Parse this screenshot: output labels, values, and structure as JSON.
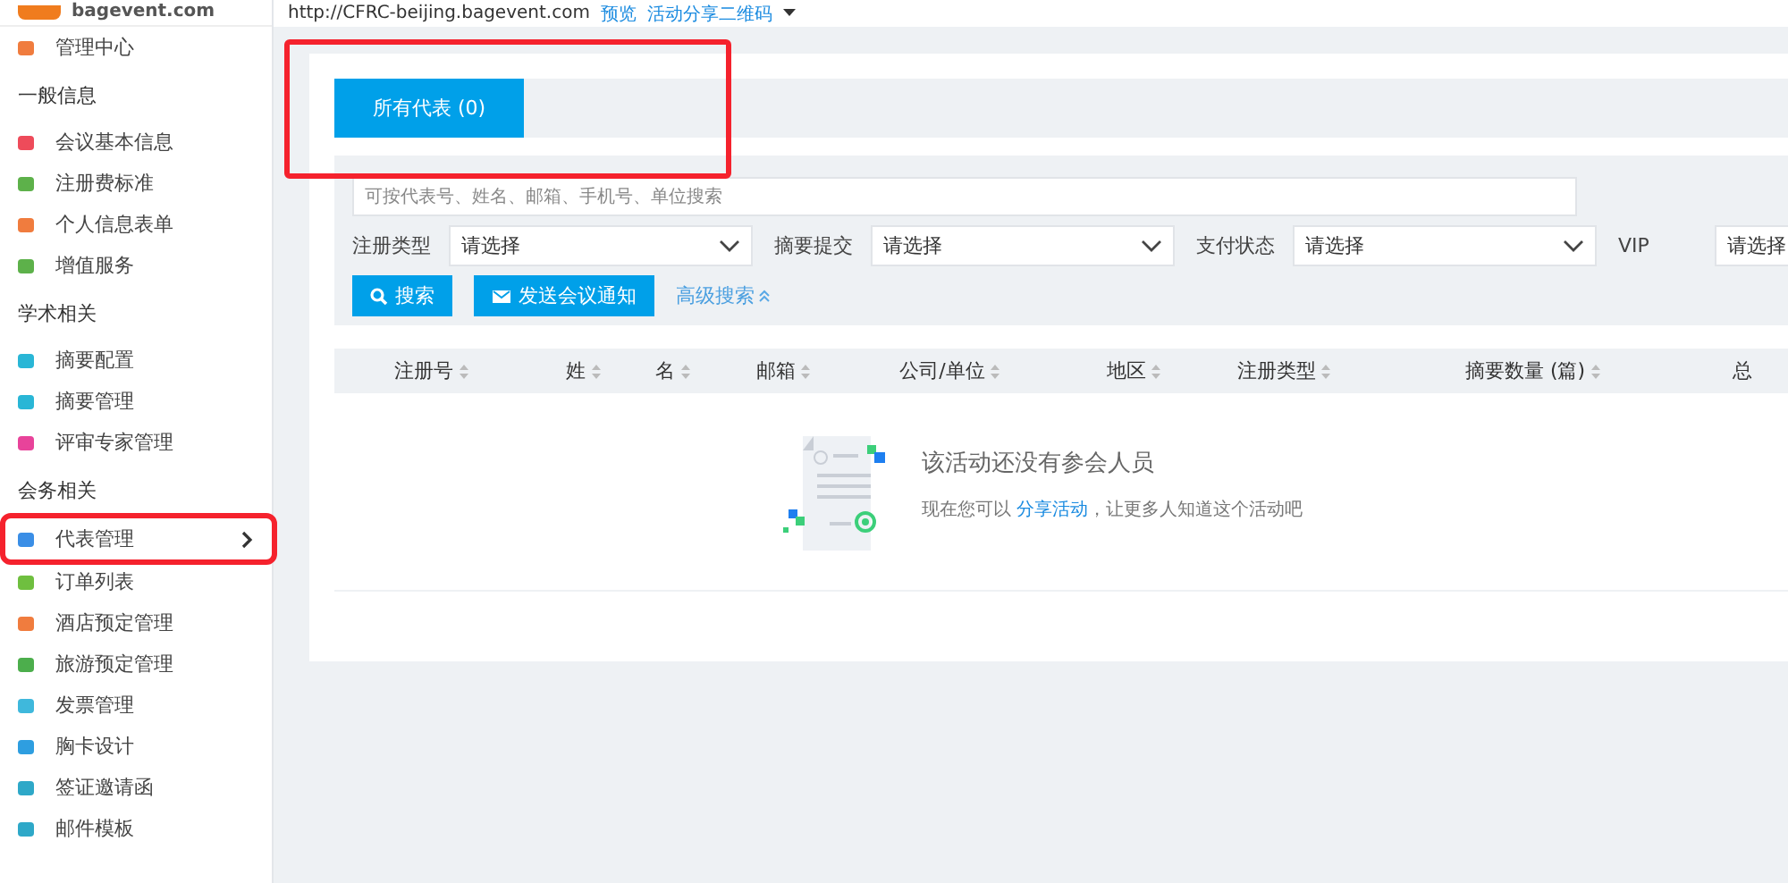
{
  "logo": {
    "text": "bagevent.com"
  },
  "topbar": {
    "url": "http://CFRC-beijing.bagevent.com",
    "links": [
      "预览",
      "活动分享二维码"
    ]
  },
  "sidebar": {
    "items": [
      {
        "kind": "link",
        "label": "管理中心",
        "color": "#f07c3e",
        "selected": false,
        "highlighted": false
      },
      {
        "kind": "heading",
        "label": "一般信息"
      },
      {
        "kind": "link",
        "label": "会议基本信息",
        "color": "#ee4b5a",
        "selected": false,
        "highlighted": false
      },
      {
        "kind": "link",
        "label": "注册费标准",
        "color": "#5db14a",
        "selected": false,
        "highlighted": false
      },
      {
        "kind": "link",
        "label": "个人信息表单",
        "color": "#f07c3e",
        "selected": false,
        "highlighted": false
      },
      {
        "kind": "link",
        "label": "增值服务",
        "color": "#5db14a",
        "selected": false,
        "highlighted": false
      },
      {
        "kind": "heading",
        "label": "学术相关"
      },
      {
        "kind": "link",
        "label": "摘要配置",
        "color": "#29b6d6",
        "selected": false,
        "highlighted": false
      },
      {
        "kind": "link",
        "label": "摘要管理",
        "color": "#29b6d6",
        "selected": false,
        "highlighted": false
      },
      {
        "kind": "link",
        "label": "评审专家管理",
        "color": "#e8439a",
        "selected": false,
        "highlighted": false
      },
      {
        "kind": "heading",
        "label": "会务相关"
      },
      {
        "kind": "link",
        "label": "代表管理",
        "color": "#3a8ee6",
        "selected": true,
        "highlighted": true
      },
      {
        "kind": "link",
        "label": "订单列表",
        "color": "#6fbf3f",
        "selected": false,
        "highlighted": false
      },
      {
        "kind": "link",
        "label": "酒店预定管理",
        "color": "#f07c3e",
        "selected": false,
        "highlighted": false
      },
      {
        "kind": "link",
        "label": "旅游预定管理",
        "color": "#4cae4c",
        "selected": false,
        "highlighted": false
      },
      {
        "kind": "link",
        "label": "发票管理",
        "color": "#3fb8dc",
        "selected": false,
        "highlighted": false
      },
      {
        "kind": "link",
        "label": "胸卡设计",
        "color": "#2e9ee0",
        "selected": false,
        "highlighted": false
      },
      {
        "kind": "link",
        "label": "签证邀请函",
        "color": "#2ea8c8",
        "selected": false,
        "highlighted": false
      },
      {
        "kind": "link",
        "label": "邮件模板",
        "color": "#2ea8c8",
        "selected": false,
        "highlighted": false
      }
    ]
  },
  "tabs": [
    {
      "label": "所有代表 (0)",
      "selected": true,
      "highlighted": true
    }
  ],
  "search": {
    "placeholder": "可按代表号、姓名、邮箱、手机号、单位搜索"
  },
  "filters": [
    {
      "label": "注册类型",
      "placeholder": "请选择"
    },
    {
      "label": "摘要提交",
      "placeholder": "请选择"
    },
    {
      "label": "支付状态",
      "placeholder": "请选择"
    },
    {
      "label": "VIP",
      "placeholder": "请选择"
    }
  ],
  "buttons": [
    "搜索",
    "发送会议通知"
  ],
  "advanced_link": "高级搜索",
  "table": {
    "columns": [
      "注册号",
      "姓",
      "名",
      "邮箱",
      "公司/单位",
      "地区",
      "注册类型",
      "摘要数量 (篇)",
      "总"
    ]
  },
  "empty_state": {
    "title": "该活动还没有参会人员",
    "text_before": "现在您可以 ",
    "link": "分享活动",
    "text_after": "，让更多人知道这个活动吧"
  }
}
